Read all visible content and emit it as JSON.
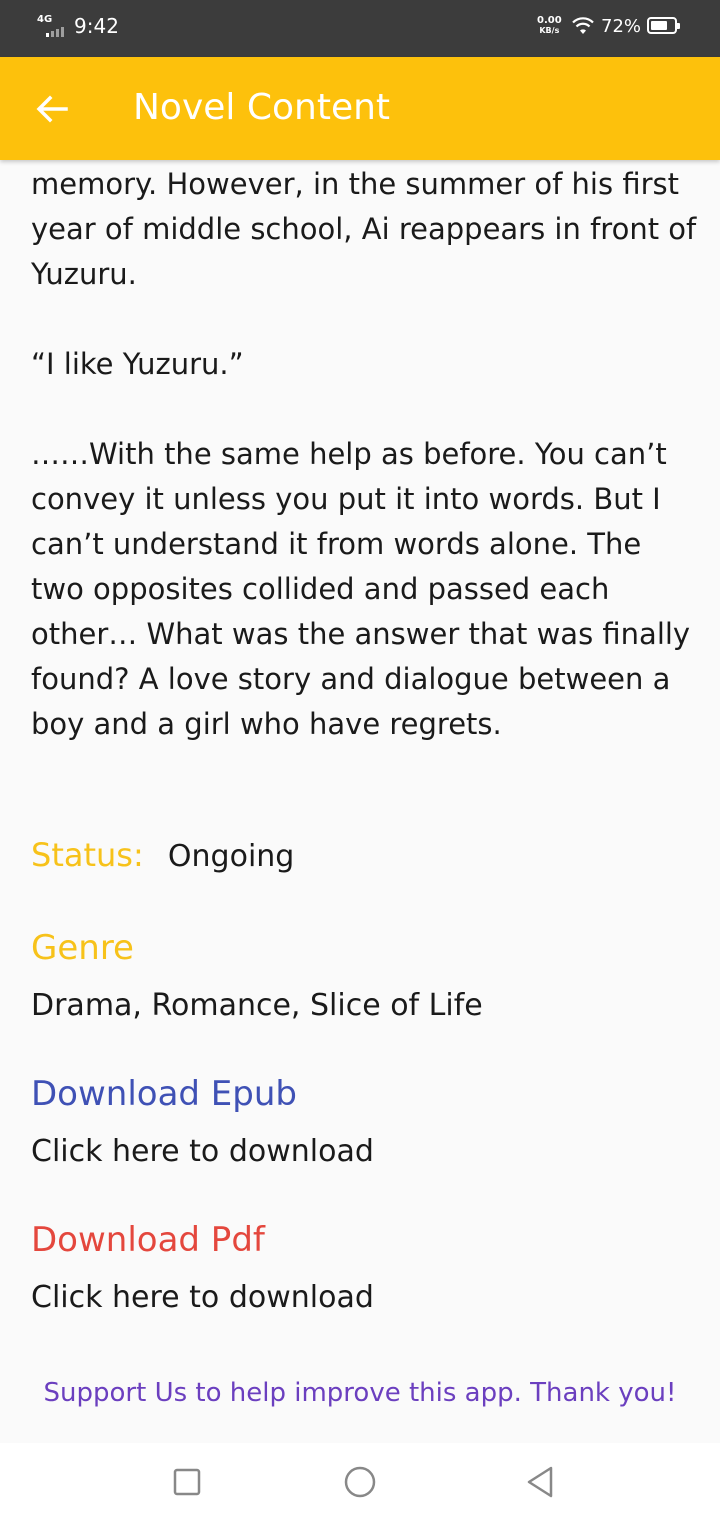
{
  "status_bar": {
    "network": "4G",
    "time": "9:42",
    "speed_value": "0.00",
    "speed_unit": "KB/s",
    "battery_percent_text": "72%",
    "battery_level": 0.72
  },
  "app_bar": {
    "title": "Novel Content",
    "back_icon": "arrow-left-icon",
    "background_color": "#fdc10c"
  },
  "description": {
    "paragraphs": [
      "memory. However, in the summer of his first year of middle school, Ai reappears in front of Yuzuru.",
      "“I like Yuzuru.”",
      "……With the same help as before. You can’t convey it unless you put it into words. But I can’t understand it from words alone. The two opposites collided and passed each other… What was the answer that was finally found? A love story and dialogue between a boy and a girl who have regrets."
    ]
  },
  "status": {
    "label": "Status:",
    "value": "Ongoing"
  },
  "genre": {
    "label": "Genre",
    "value": "Drama, Romance, Slice of Life"
  },
  "epub": {
    "title": "Download Epub",
    "link": "Click here to download"
  },
  "pdf": {
    "title": "Download Pdf",
    "link": "Click here to download"
  },
  "support_text": "Support Us to help improve this app. Thank you!",
  "colors": {
    "accent": "#fdc10c",
    "label_yellow": "#f7c21a",
    "epub_blue": "#3f51b5",
    "pdf_red": "#e4473d",
    "support_purple": "#6b3fbf"
  },
  "nav": {
    "recents_icon": "square-icon",
    "home_icon": "circle-icon",
    "back_icon": "triangle-back-icon"
  }
}
